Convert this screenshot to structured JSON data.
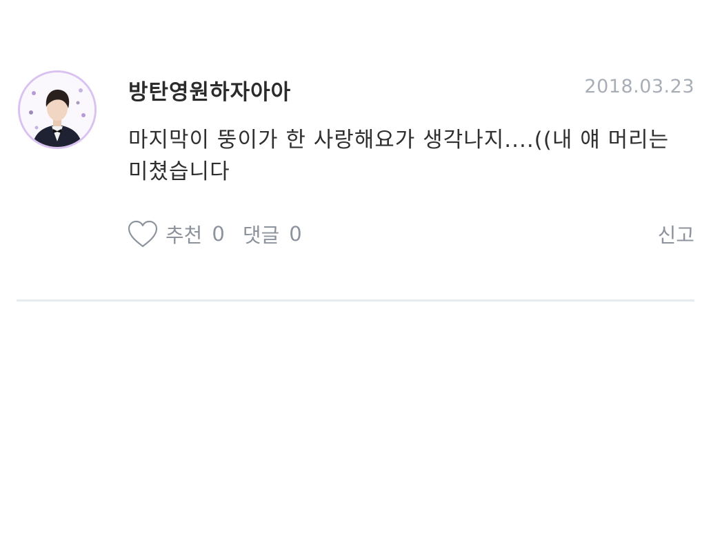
{
  "comment": {
    "username": "방탄영원하자아아",
    "date": "2018.03.23",
    "text": "마지막이 뚱이가 한 사랑해요가 생각나지....((내 얘 머리는 미쳤습니다",
    "avatar_icon": "profile-photo",
    "actions": {
      "like_label": "추천",
      "like_count": "0",
      "reply_label": "댓글",
      "reply_count": "0",
      "report_label": "신고"
    }
  },
  "colors": {
    "accent": "#d9c2f2",
    "muted": "#8d939c",
    "date": "#a8aeb6",
    "divider": "#e6ebef"
  }
}
